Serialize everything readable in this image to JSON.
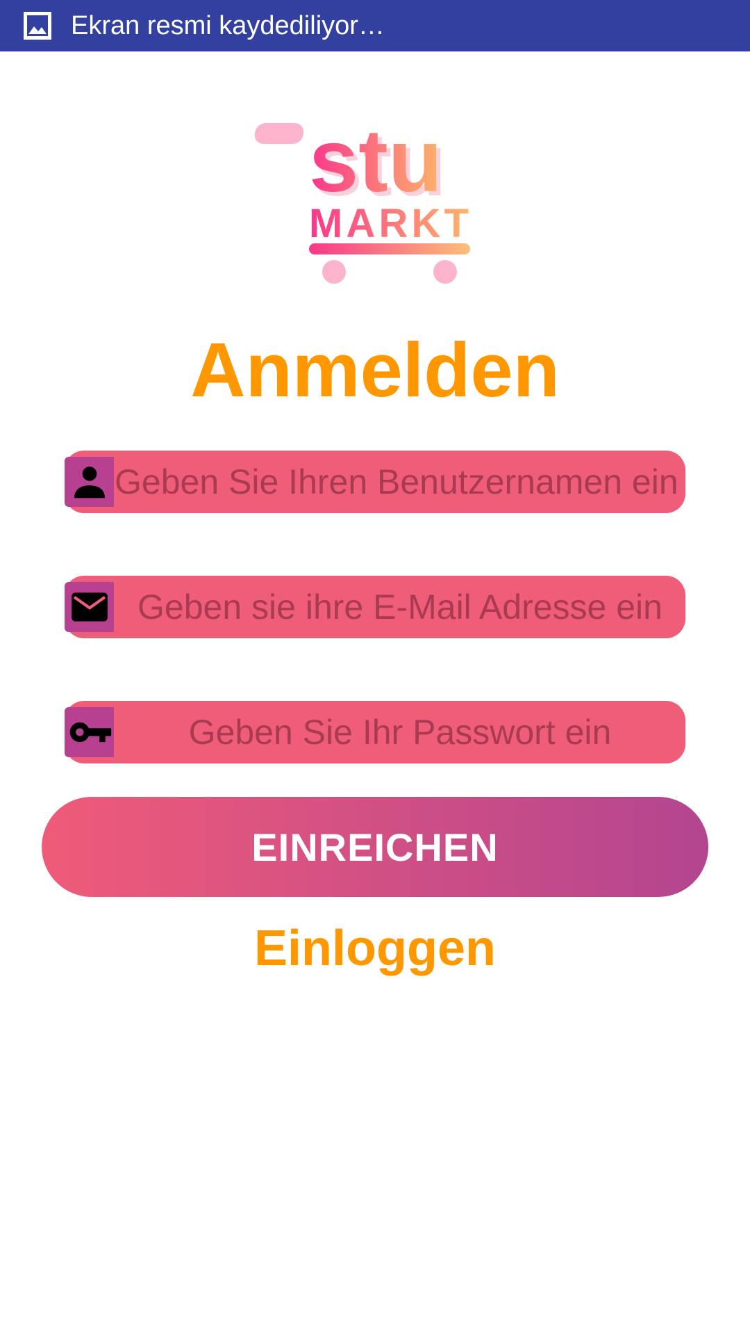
{
  "status_bar": {
    "icon": "image-icon",
    "text": "Ekran resmi kaydediliyor…",
    "background": "#33409f"
  },
  "logo": {
    "line1": "stu",
    "line2": "MARKT",
    "icon": "shopping-cart-icon"
  },
  "form": {
    "title": "Anmelden",
    "username": {
      "icon": "person-icon",
      "placeholder": "Geben Sie Ihren Benutzernamen ein"
    },
    "email": {
      "icon": "mail-icon",
      "placeholder": "Geben sie ihre E-Mail Adresse ein"
    },
    "password": {
      "icon": "key-icon",
      "placeholder": "Geben Sie Ihr Passwort ein"
    },
    "submit_label": "EINREICHEN",
    "login_link": "Einloggen"
  },
  "colors": {
    "accent_orange": "#ff9800",
    "field_bg": "#f05d78",
    "field_text": "#a83a52",
    "icon_box": "#b74190",
    "button_gradient_start": "#ef5b79",
    "button_gradient_end": "#b3458f"
  }
}
